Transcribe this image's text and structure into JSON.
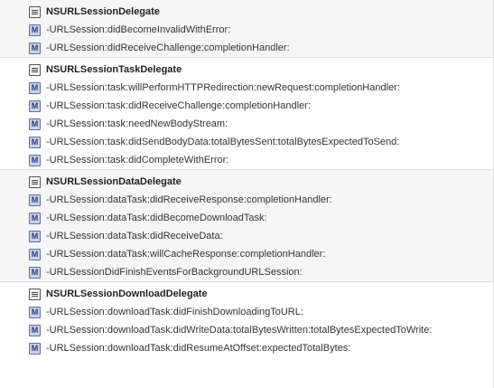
{
  "sections": [
    {
      "title": "NSURLSessionDelegate",
      "methods": [
        "-URLSession:didBecomeInvalidWithError:",
        "-URLSession:didReceiveChallenge:completionHandler:"
      ]
    },
    {
      "title": "NSURLSessionTaskDelegate",
      "methods": [
        "-URLSession:task:willPerformHTTPRedirection:newRequest:completionHandler:",
        "-URLSession:task:didReceiveChallenge:completionHandler:",
        "-URLSession:task:needNewBodyStream:",
        "-URLSession:task:didSendBodyData:totalBytesSent:totalBytesExpectedToSend:",
        "-URLSession:task:didCompleteWithError:"
      ]
    },
    {
      "title": "NSURLSessionDataDelegate",
      "methods": [
        "-URLSession:dataTask:didReceiveResponse:completionHandler:",
        "-URLSession:dataTask:didBecomeDownloadTask:",
        "-URLSession:dataTask:didReceiveData:",
        "-URLSession:dataTask:willCacheResponse:completionHandler:",
        "-URLSessionDidFinishEventsForBackgroundURLSession:"
      ]
    },
    {
      "title": "NSURLSessionDownloadDelegate",
      "methods": [
        "-URLSession:downloadTask:didFinishDownloadingToURL:",
        "-URLSession:downloadTask:didWriteData:totalBytesWritten:totalBytesExpectedToWrite:",
        "-URLSession:downloadTask:didResumeAtOffset:expectedTotalBytes:"
      ]
    }
  ],
  "icons": {
    "method_glyph": "M",
    "method_icon": "method-icon",
    "header_icon": "document-icon"
  },
  "colors": {
    "method_icon_fill": "#c9d2ea",
    "method_icon_border": "#5d6fa7",
    "section_alt_background": "#f6f6f6"
  }
}
